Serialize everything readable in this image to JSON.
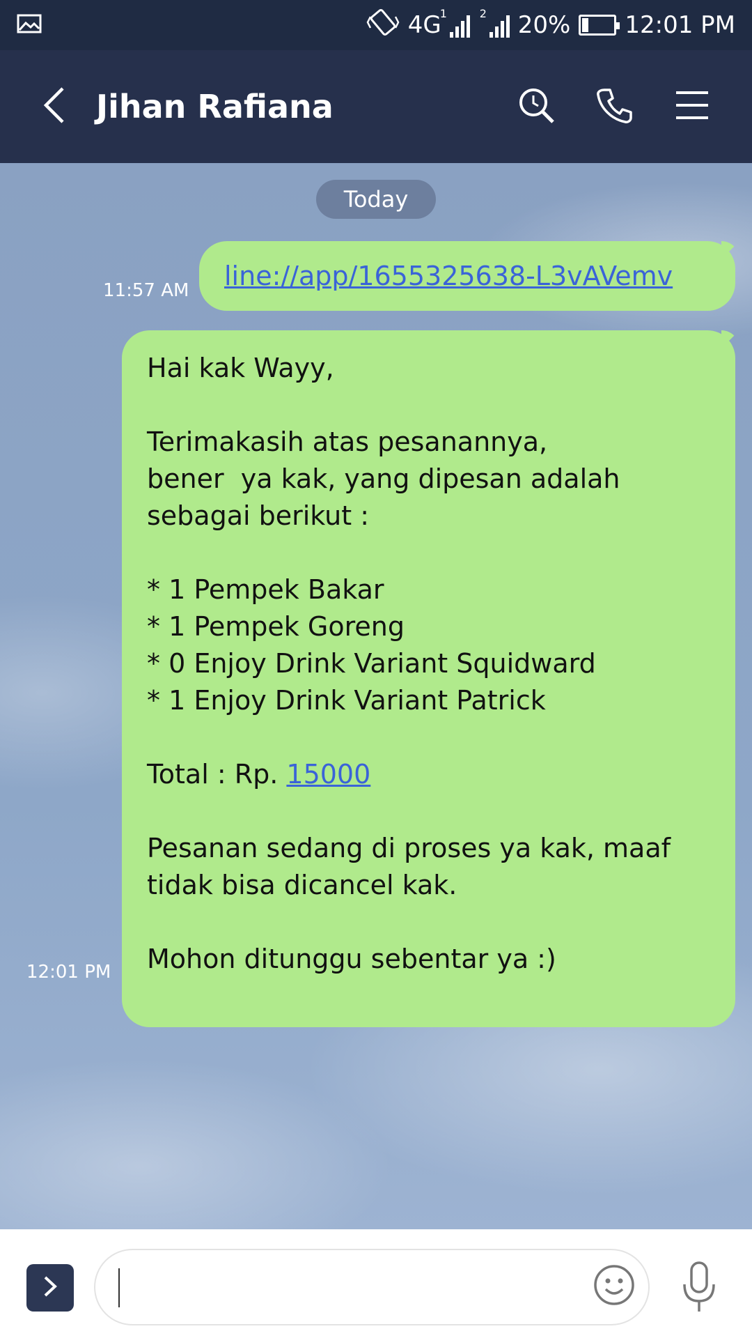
{
  "status_bar": {
    "network": "4G",
    "sim1": "1",
    "sim2": "2",
    "battery": "20%",
    "battery_level": 0.2,
    "time": "12:01 PM",
    "icons": [
      "gallery-icon",
      "vibrate-icon",
      "signal-icon",
      "battery-icon"
    ]
  },
  "header": {
    "title": "Jihan Rafiana",
    "icons": [
      "back-icon",
      "search-icon",
      "phone-icon",
      "menu-icon"
    ]
  },
  "chat": {
    "date_label": "Today",
    "messages": [
      {
        "time": "11:57 AM",
        "link": "line://app/1655325638-L3vAVemv"
      },
      {
        "time": "12:01 PM",
        "lines": [
          "Hai kak Wayy,",
          "",
          "Terimakasih atas pesanannya,",
          "bener  ya kak, yang dipesan adalah",
          "sebagai berikut :",
          "",
          "* 1 Pempek Bakar",
          "* 1 Pempek Goreng",
          "* 0 Enjoy Drink Variant Squidward",
          "* 1 Enjoy Drink Variant Patrick",
          "",
          "Total : Rp. ",
          "",
          "Pesanan sedang di proses ya kak, maaf",
          "tidak bisa dicancel kak.",
          "",
          "Mohon ditunggu sebentar ya :)"
        ],
        "total_link": "15000"
      }
    ]
  },
  "input_bar": {
    "value": "",
    "icons": [
      "expand-icon",
      "emoji-icon",
      "mic-icon"
    ]
  },
  "colors": {
    "header_bg": "#26304c",
    "bubble_green": "#b0ea8c",
    "link_blue": "#3a63d8"
  }
}
